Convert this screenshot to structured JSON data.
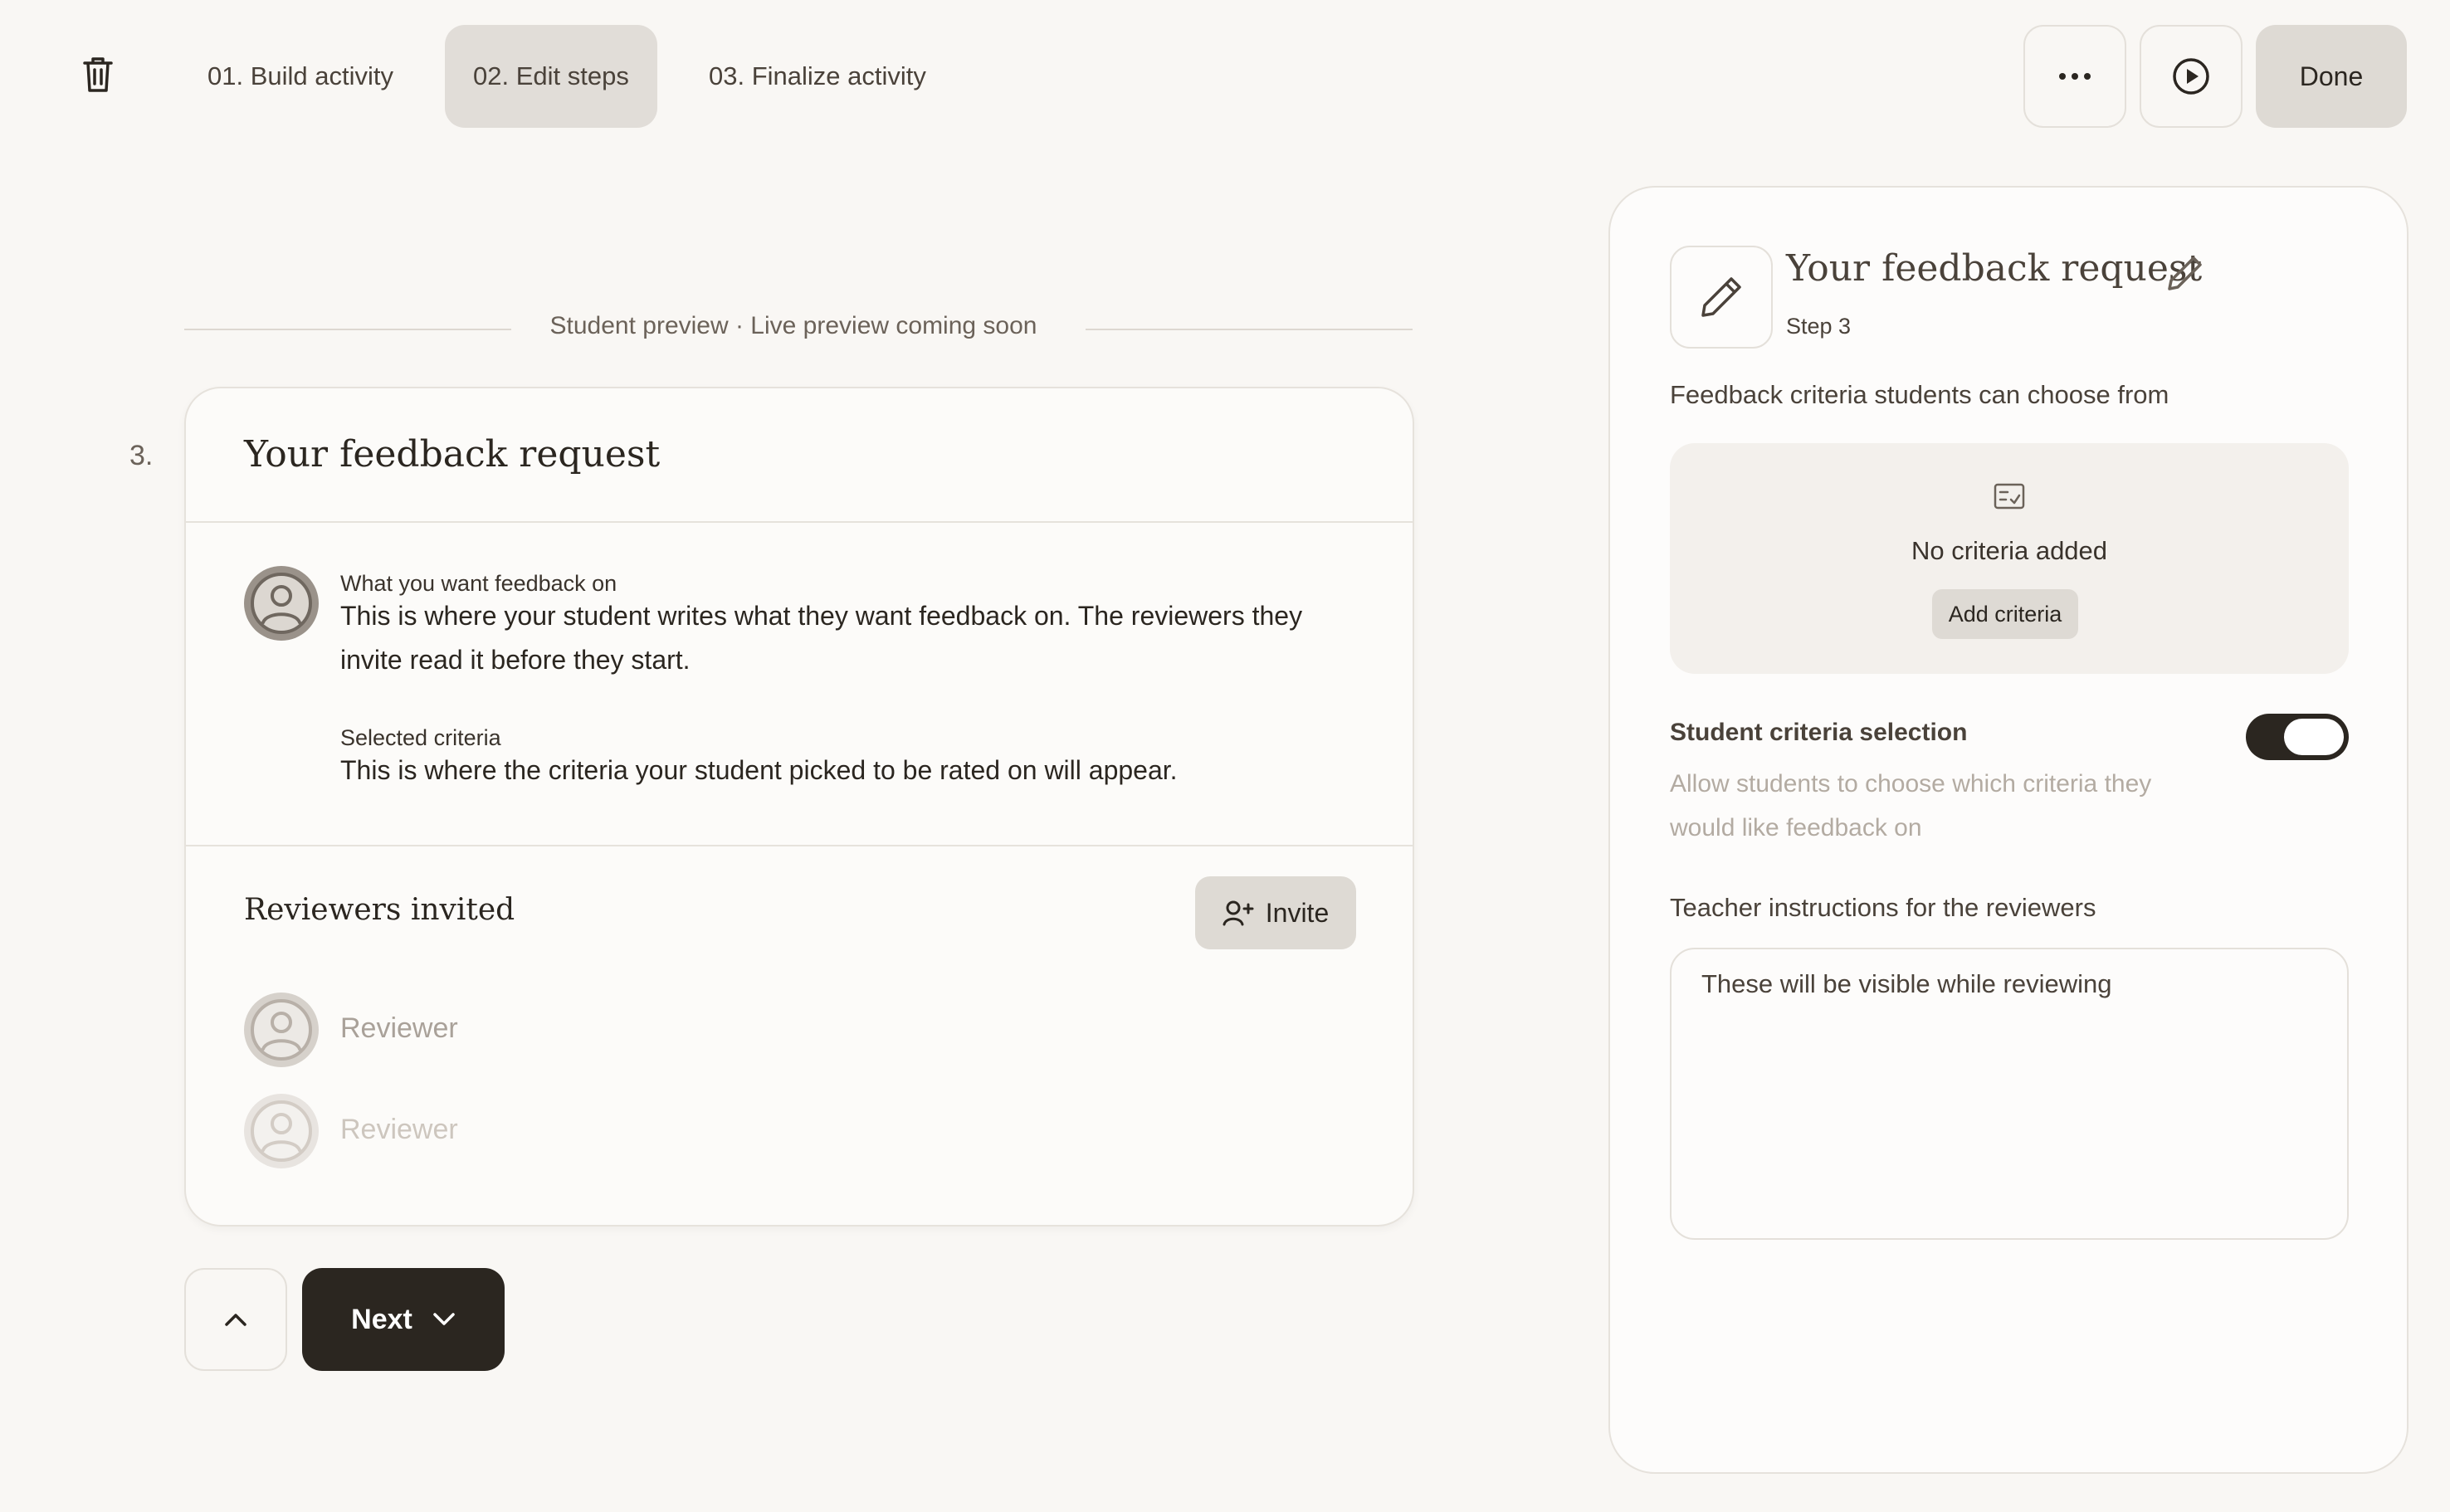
{
  "topbar": {
    "tabs": [
      {
        "label": "01. Build activity",
        "active": false
      },
      {
        "label": "02. Edit steps",
        "active": true
      },
      {
        "label": "03. Finalize activity",
        "active": false
      }
    ],
    "more_icon": "more-horizontal-icon",
    "play_icon": "play-circle-icon",
    "done_label": "Done"
  },
  "preview": {
    "label": "Student preview · Live preview coming soon",
    "step_number": "3.",
    "card": {
      "title": "Your feedback request",
      "fields": [
        {
          "label": "What you want feedback on",
          "text_line1": "This is where your student writes what they want feedback on. The reviewers they",
          "text_line2": "invite read it before they start."
        },
        {
          "label": "Selected criteria",
          "text": "This is where the criteria your student picked to be rated on will appear."
        }
      ],
      "reviewers_title": "Reviewers invited",
      "invite_label": "Invite",
      "reviewers": [
        {
          "name": "Reviewer"
        },
        {
          "name": "Reviewer"
        }
      ]
    },
    "next_label": "Next"
  },
  "panel": {
    "title": "Your feedback request",
    "step": "Step 3",
    "criteria_label": "Feedback criteria students can choose from",
    "criteria_empty": "No criteria added",
    "add_criteria_label": "Add criteria",
    "toggle_title": "Student criteria selection",
    "toggle_on": true,
    "toggle_desc_line1": "Allow students to choose which criteria they",
    "toggle_desc_line2": "would like feedback on",
    "instructions_label": "Teacher instructions for the reviewers",
    "instructions_placeholder": "These will be visible while reviewing"
  },
  "colors": {
    "background": "#f9f7f4",
    "accent_dark": "#2b2620",
    "active_tab": "#e1ddd8"
  }
}
